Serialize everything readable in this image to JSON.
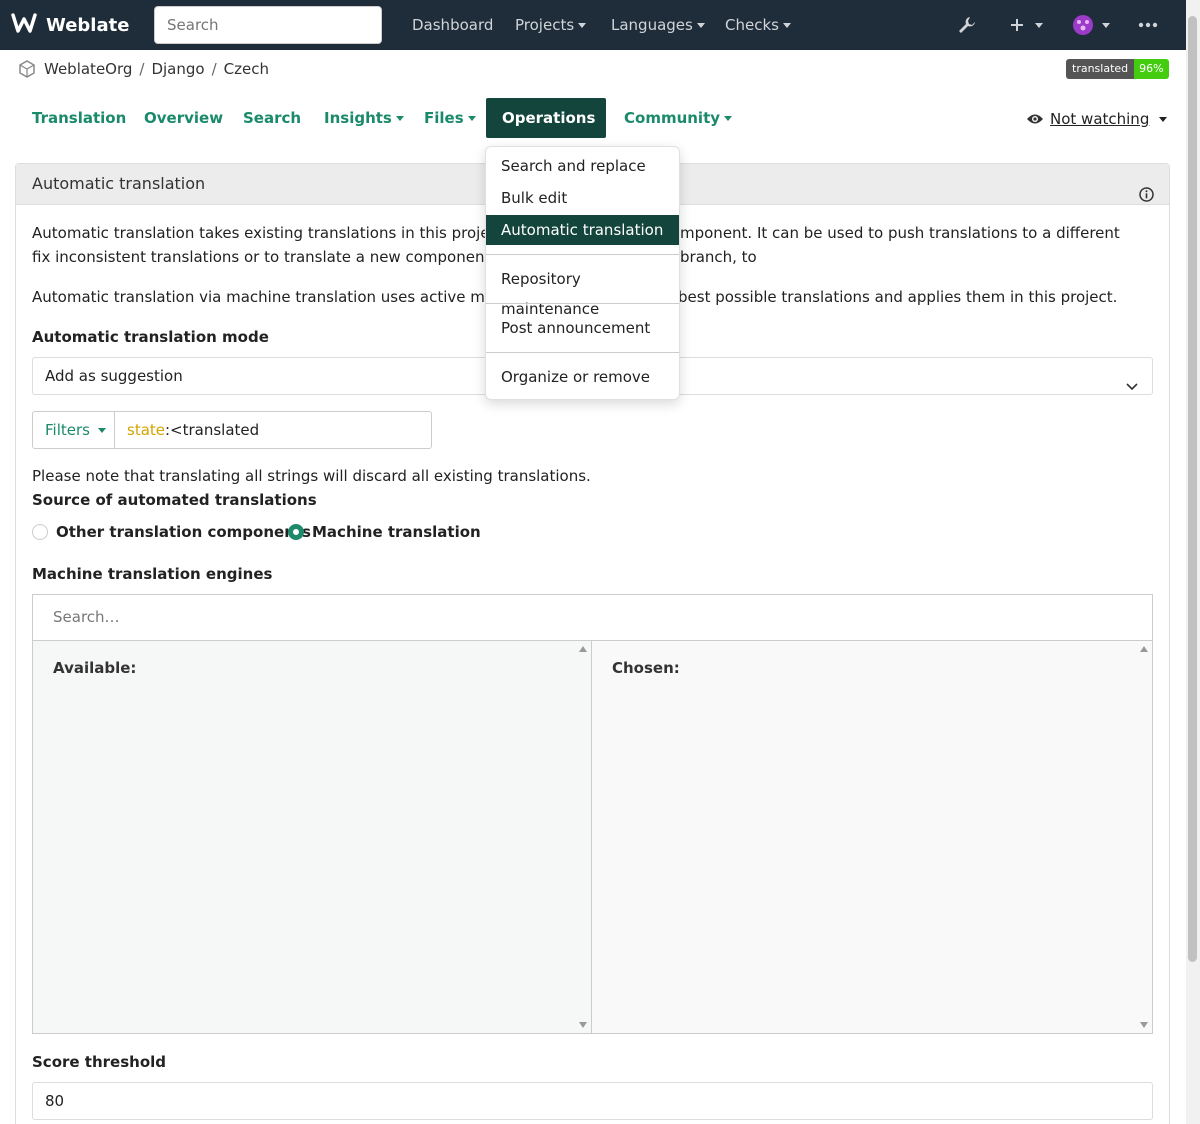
{
  "navbar": {
    "brand": "Weblate",
    "search_placeholder": "Search",
    "items": [
      "Dashboard",
      "Projects",
      "Languages",
      "Checks"
    ]
  },
  "breadcrumb": [
    "WeblateOrg",
    "Django",
    "Czech"
  ],
  "badge": {
    "label": "translated",
    "value": "96%"
  },
  "tabs": [
    "Translation",
    "Overview",
    "Search",
    "Insights",
    "Files",
    "Operations",
    "Community"
  ],
  "watch": "Not watching",
  "panel": {
    "title": "Automatic translation",
    "para1": "Automatic translation takes existing translations in this project and a",
    "para1_end": "mponent. It can be used to push translations to a different branch, to",
    "para1_line2": "fix inconsistent translations or to translate a new component using t",
    "para2": "Automatic translation via machine translation uses active machine tr",
    "para2_end": "best possible translations and applies them in this project.",
    "mode_label": "Automatic translation mode",
    "mode_value": "Add as suggestion",
    "filters_label": "Filters",
    "filter_keyword": "state",
    "filter_value": ":<translated",
    "note": "Please note that translating all strings will discard all existing translations.",
    "source_label": "Source of automated translations",
    "radio_other": "Other translation components",
    "radio_mt": "Machine translation",
    "engines_label": "Machine translation engines",
    "engines_search_placeholder": "Search…",
    "available_label": "Available:",
    "chosen_label": "Chosen:",
    "score_label": "Score threshold",
    "score_value": "80"
  },
  "dropdown": {
    "items": [
      "Search and replace",
      "Bulk edit",
      "Automatic translation",
      "Repository maintenance",
      "Post announcement",
      "Organize or remove"
    ],
    "active_item": "Automatic translation"
  },
  "colors": {
    "navbar": "#1f2d3a",
    "accent": "#1a8a6a",
    "active": "#14453c"
  }
}
